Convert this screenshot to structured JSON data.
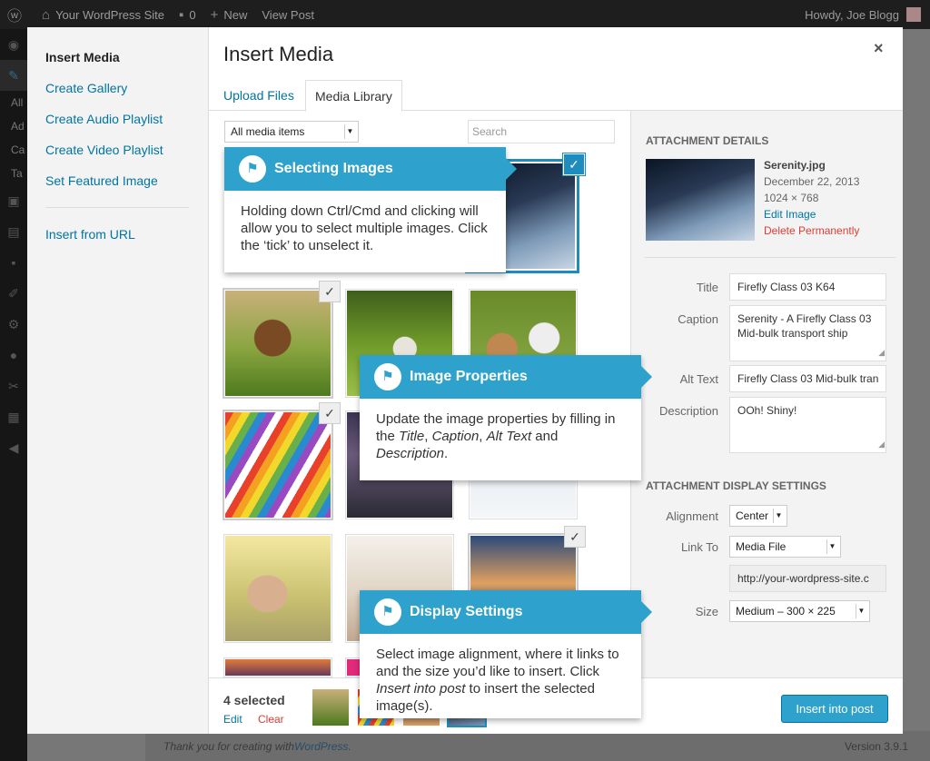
{
  "adminbar": {
    "site_name": "Your WordPress Site",
    "comments_count": "0",
    "new_label": "New",
    "view_post": "View Post",
    "howdy": "Howdy, Joe Blogg"
  },
  "adminmenu": {
    "labels": [
      "All",
      "Ad",
      "Ca",
      "Ta"
    ]
  },
  "footer": {
    "thanks_prefix": "Thank you for creating with ",
    "thanks_link": "WordPress",
    "thanks_suffix": ".",
    "version": "Version 3.9.1"
  },
  "modal": {
    "menu": {
      "title": "Insert Media",
      "items": [
        "Create Gallery",
        "Create Audio Playlist",
        "Create Video Playlist",
        "Set Featured Image"
      ],
      "insert_url": "Insert from URL"
    },
    "title": "Insert Media",
    "close": "×",
    "tabs": [
      "Upload Files",
      "Media Library"
    ],
    "filter": "All media items",
    "search_placeholder": "Search",
    "selection": {
      "count": "4 selected",
      "edit": "Edit",
      "clear": "Clear"
    },
    "insert_button": "Insert into post"
  },
  "details": {
    "heading": "Attachment Details",
    "filename": "Serenity.jpg",
    "date": "December 22, 2013",
    "dimensions": "1024 × 768",
    "edit_image": "Edit Image",
    "delete": "Delete Permanently",
    "title_label": "Title",
    "title_value": "Firefly Class 03 K64",
    "caption_label": "Caption",
    "caption_value": "Serenity - A Firefly Class 03 Mid-bulk transport ship",
    "alt_label": "Alt Text",
    "alt_value": "Firefly Class 03 Mid-bulk tran",
    "description_label": "Description",
    "description_value": "OOh! Shiny!"
  },
  "display": {
    "heading": "Attachment Display Settings",
    "alignment_label": "Alignment",
    "alignment_value": "Center",
    "link_label": "Link To",
    "link_value": "Media File",
    "url_value": "http://your-wordpress-site.c",
    "size_label": "Size",
    "size_value": "Medium – 300 × 225"
  },
  "pointers": {
    "selecting": {
      "title": "Selecting Images",
      "body": "Holding down Ctrl/Cmd and clicking will allow you to select multiple images. Click the ‘tick’ to unselect it."
    },
    "properties": {
      "title": "Image Properties",
      "body_1": "Update the image properties by filling in the ",
      "em_title": "Title",
      "sep_1": ", ",
      "em_caption": "Caption",
      "sep_2": ", ",
      "em_alt": "Alt Text",
      "sep_3": " and ",
      "em_desc": "Description",
      "body_end": "."
    },
    "display": {
      "title": "Display Settings",
      "body_1": "Select image alignment, where it links to and the size you’d like to insert. Click ",
      "em_insert": "Insert into post",
      "body_2": " to insert the selected image(s)."
    }
  },
  "icons": {
    "check": "✓",
    "flag": "⚑"
  },
  "colors": {
    "accent": "#2ea2cc",
    "link": "#0074a2",
    "delete": "#dd3d36"
  }
}
